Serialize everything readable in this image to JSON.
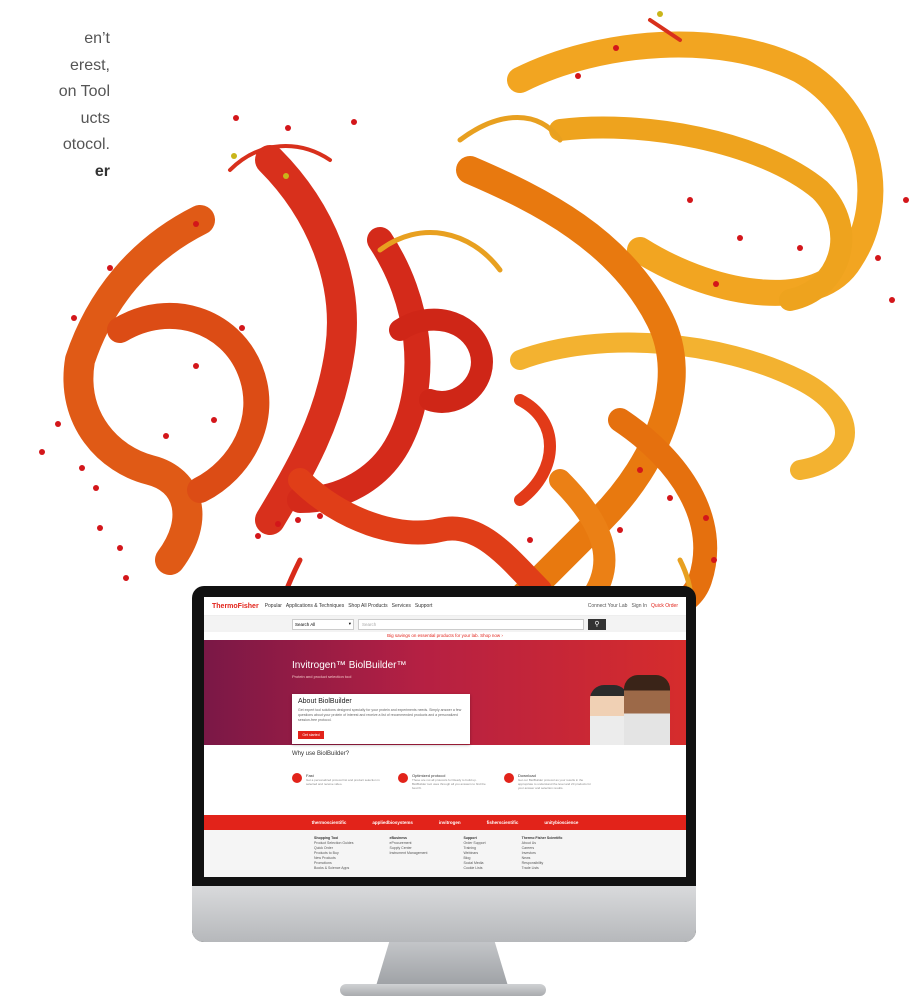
{
  "intro_text": [
    "en’t",
    "erest,",
    "on Tool",
    "ucts",
    "otocol.",
    "er"
  ],
  "screen": {
    "nav": {
      "logo": "ThermoFisher",
      "links": [
        "Popular",
        "Applications & Techniques",
        "Shop All Products",
        "Services",
        "Support"
      ],
      "right": [
        "Connect Your Lab",
        "Sign In",
        "Quick Order"
      ]
    },
    "search": {
      "select_label": "Search All",
      "placeholder": "Search"
    },
    "promo": "Big savings on essential products for your lab. Shop now ›",
    "hero": {
      "title": "Invitrogen™ BiolBuilder™",
      "subtitle": "Protein and product selection tool",
      "card_title": "About BiolBuilder",
      "card_text": "Get expert tool solutions designed specially for your protein and experiments needs. Simply answer a few questions about your protein of interest and receive a list of recommended products and a personalized session-free protocol.",
      "card_button": "Get started"
    },
    "why_title": "Why use BiolBuilder?",
    "features": [
      {
        "title": "Fast",
        "text": "Get a personalized protocol list and product selection in selected and receive video."
      },
      {
        "title": "Optimized protocol",
        "text": "These are not all protocols for Ready to build up. BiolBuilder tool uses through all you answers to find the best fit."
      },
      {
        "title": "Download",
        "text": "Get our BiolBuilder protocol as your results in the appropriate to understand the level and 20 products for your answer and selection results."
      }
    ],
    "brands": [
      "thermoscientific",
      "appliedbiosystems",
      "invitrogen",
      "fisherscientific",
      "unitybioscience"
    ],
    "footer": [
      {
        "heading": "Shopping Tool",
        "items": [
          "Product Selection Guides",
          "Quick Order",
          "Products to Buy",
          "New Products",
          "Promotions",
          "Books & Science Apps"
        ]
      },
      {
        "heading": "eBusiness",
        "items": [
          "eProcurement",
          "Supply Center",
          "Instrument Management"
        ]
      },
      {
        "heading": "Support",
        "items": [
          "Order Support",
          "Training",
          "Webinars",
          "Blog",
          "Social Media",
          "Cookie Lists"
        ]
      },
      {
        "heading": "Thermo Fisher Scientific",
        "items": [
          "About Us",
          "Careers",
          "Investors",
          "News",
          "Responsibility",
          "Trade Lists"
        ]
      }
    ]
  },
  "colors": {
    "brand_red": "#e2231a",
    "hero_start": "#7a1846",
    "hero_end": "#d62c2c",
    "ribbon_orange": "#e8790f",
    "ribbon_red": "#d8301c",
    "ribbon_gold": "#f0a01c"
  }
}
